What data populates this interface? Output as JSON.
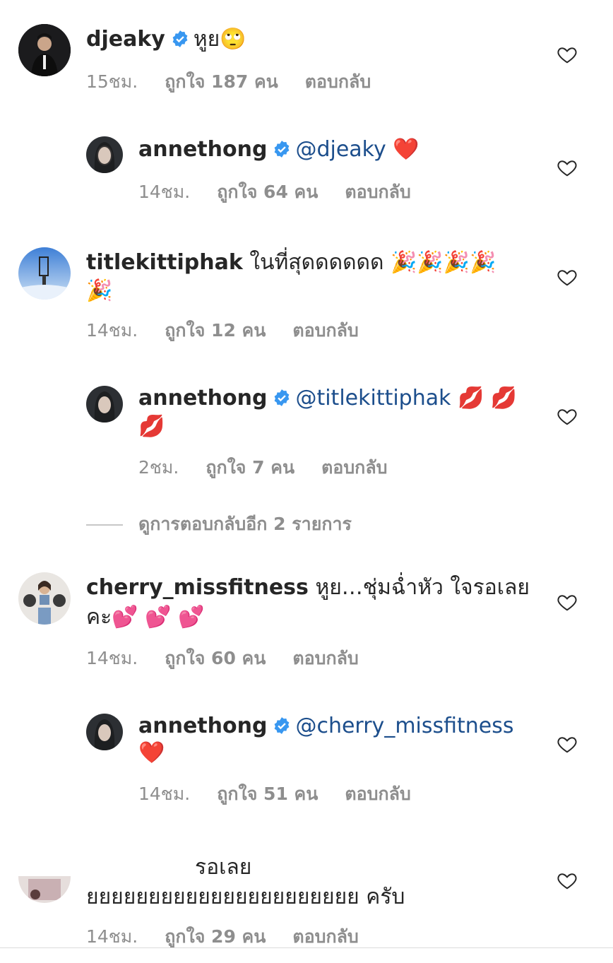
{
  "comments": [
    {
      "username": "djeaky",
      "text": "หูย",
      "emoji": "🙄",
      "time": "15ชม.",
      "likes": "ถูกใจ 187 คน",
      "reply": "ตอบกลับ"
    },
    {
      "username": "annethong",
      "mention": "@djeaky",
      "emoji": "❤️",
      "time": "14ชม.",
      "likes": "ถูกใจ 64 คน",
      "reply": "ตอบกลับ"
    },
    {
      "username": "titlekittiphak",
      "text": "ในที่สุดดดดดด",
      "emoji": "🎉🎉🎉🎉",
      "emoji2": "🎉",
      "time": "14ชม.",
      "likes": "ถูกใจ 12 คน",
      "reply": "ตอบกลับ"
    },
    {
      "username": "annethong",
      "mention": "@titlekittiphak",
      "emoji": "💋 💋",
      "emoji2": "💋",
      "time": "2ชม.",
      "likes": "ถูกใจ 7 คน",
      "reply": "ตอบกลับ"
    },
    {
      "username": "cherry_missfitness",
      "text": "หูย…ชุ่มฉ่ำหัว ใจรอเลย",
      "text2": "คะ",
      "emoji2": "💕 💕 💕",
      "time": "14ชม.",
      "likes": "ถูกใจ 60 คน",
      "reply": "ตอบกลับ"
    },
    {
      "username": "annethong",
      "mention": "@cherry_missfitness",
      "emoji2": "❤️",
      "time": "14ชม.",
      "likes": "ถูกใจ 51 คน",
      "reply": "ตอบกลับ"
    },
    {
      "text": "รอเลย",
      "text2": "ยยยยยยยยยยยยยยยยยยยยยย ครับ",
      "time": "14ชม.",
      "likes": "ถูกใจ 29 คน",
      "reply": "ตอบกลับ"
    }
  ],
  "view_more_replies": "ดูการตอบกลับอีก 2 รายการ",
  "colors": {
    "mention": "#1c4e8c",
    "verified": "#3897f0",
    "meta": "#8e8e8e"
  }
}
